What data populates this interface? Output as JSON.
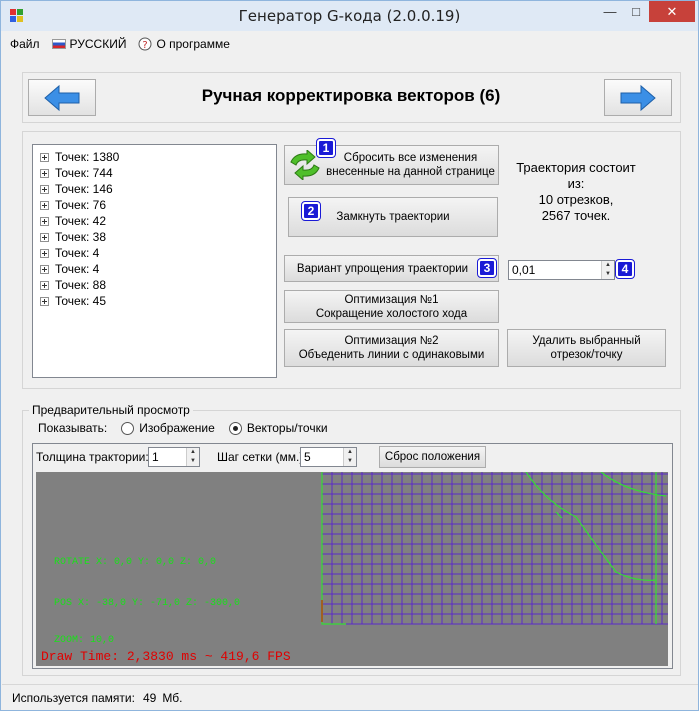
{
  "window": {
    "title": "Генератор G-кода (2.0.0.19)",
    "minimize": "—",
    "maximize": "□",
    "close": "✕"
  },
  "menu": {
    "file": "Файл",
    "language": "РУССКИЙ",
    "about": "О программе"
  },
  "nav": {
    "title": "Ручная корректировка векторов (6)"
  },
  "tree": {
    "items": [
      "Точек: 1380",
      "Точек: 744",
      "Точек: 146",
      "Точек: 76",
      "Точек: 42",
      "Точек: 38",
      "Точек: 4",
      "Точек: 4",
      "Точек: 88",
      "Точек: 45"
    ]
  },
  "actions": {
    "reset_line1": "Сбросить все изменения",
    "reset_line2": "внесенные на данной странице",
    "close_paths": "Замкнуть траектории",
    "simplify": "Вариант упрощения траектории",
    "simplify_value": "0,01",
    "opt1_line1": "Оптимизация №1",
    "opt1_line2": "Сокращение холостого хода",
    "opt2_line1": "Оптимизация №2",
    "opt2_line2": "Объеденить линии с одинаковыми",
    "delete_line1": "Удалить выбранный",
    "delete_line2": "отрезок/точку"
  },
  "badges": {
    "b1": "1",
    "b2": "2",
    "b3": "3",
    "b4": "4"
  },
  "summary": {
    "line1": "Траектория состоит",
    "line2": "из:",
    "line3": "10 отрезков,",
    "line4": "2567 точек."
  },
  "preview": {
    "group_label": "Предварительный просмотр",
    "show_label": "Показывать:",
    "option_image": "Изображение",
    "option_vectors": "Векторы/точки",
    "selected": "Векторы/точки",
    "thickness_label": "Толщина трактории:",
    "thickness_value": "1",
    "grid_label": "Шаг сетки (мм.):",
    "grid_value": "5",
    "reset_position": "Сброс положения",
    "rotate": "ROTATE X: 0,0  Y: 0,0 Z: 0,0",
    "pos": "POS X: -38,0  Y: -71,0 Z: -300,0",
    "zoom": "ZOOM: 10,0",
    "fps": "Draw Time: 2,3830 ms ~ 419,6 FPS"
  },
  "status": {
    "memory_label": "Используется памяти:",
    "memory_value": "49",
    "memory_unit": "Мб."
  },
  "colors": {
    "grid": "#5a2bc8",
    "path": "#33dd33",
    "viewport_bg": "#808080",
    "badge": "#1a1ad6"
  }
}
